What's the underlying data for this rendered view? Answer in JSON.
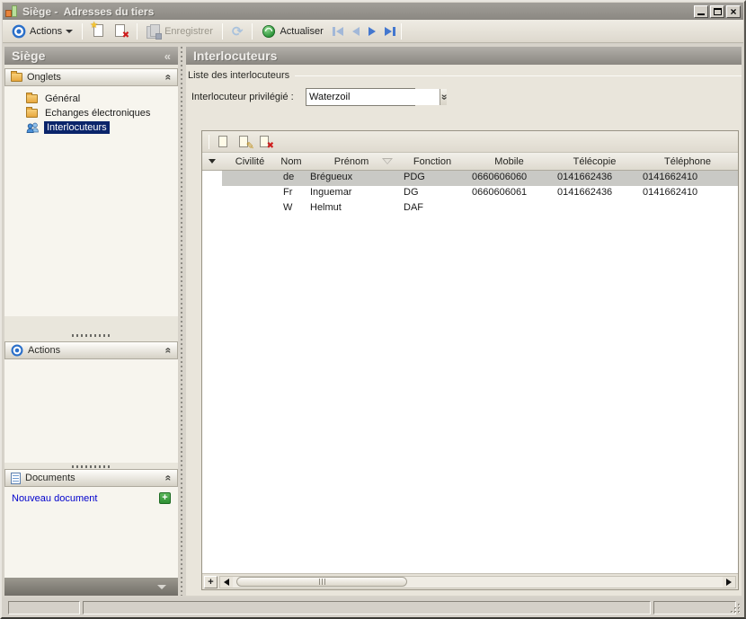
{
  "window": {
    "title": "Siège -  Adresses du tiers"
  },
  "toolbar": {
    "actions_label": "Actions",
    "save_label": "Enregistrer",
    "refresh_label": "Actualiser"
  },
  "sidebar": {
    "title": "Siège",
    "collapse_glyph": "«",
    "chevron_glyph": "«",
    "onglets": {
      "label": "Onglets",
      "items": [
        {
          "label": "Général"
        },
        {
          "label": "Echanges électroniques"
        },
        {
          "label": "Interlocuteurs"
        }
      ]
    },
    "actions_section": {
      "label": "Actions"
    },
    "documents_section": {
      "label": "Documents",
      "new_document_link": "Nouveau document",
      "add_glyph": "+"
    }
  },
  "main": {
    "title": "Interlocuteurs",
    "group_label": "Liste des interlocuteurs",
    "privileged": {
      "label": "Interlocuteur privilégié :",
      "value": "Waterzoil"
    },
    "grid": {
      "columns": {
        "civilite": "Civilité",
        "nom": "Nom",
        "prenom": "Prénom",
        "fonction": "Fonction",
        "mobile": "Mobile",
        "telecopie": "Télécopie",
        "telephone": "Téléphone"
      },
      "rows": [
        {
          "civilite": "",
          "nom": "de",
          "prenom": "Brégueux",
          "fonction": "PDG",
          "mobile": "0660606060",
          "telecopie": "0141662436",
          "telephone": "0141662410"
        },
        {
          "civilite": "",
          "nom": "Fr",
          "prenom": "Inguemar",
          "fonction": "DG",
          "mobile": "0660606061",
          "telecopie": "0141662436",
          "telephone": "0141662410"
        },
        {
          "civilite": "",
          "nom": "W",
          "prenom": "Helmut",
          "fonction": "DAF",
          "mobile": "",
          "telecopie": "",
          "telephone": ""
        }
      ]
    }
  },
  "colors": {
    "selection_navy": "#0a246a",
    "row_selection_gray": "#c9c9c5",
    "accent_blue": "#2a6fc9",
    "accent_green": "#2e9e3c",
    "link_blue": "#0000cc"
  }
}
